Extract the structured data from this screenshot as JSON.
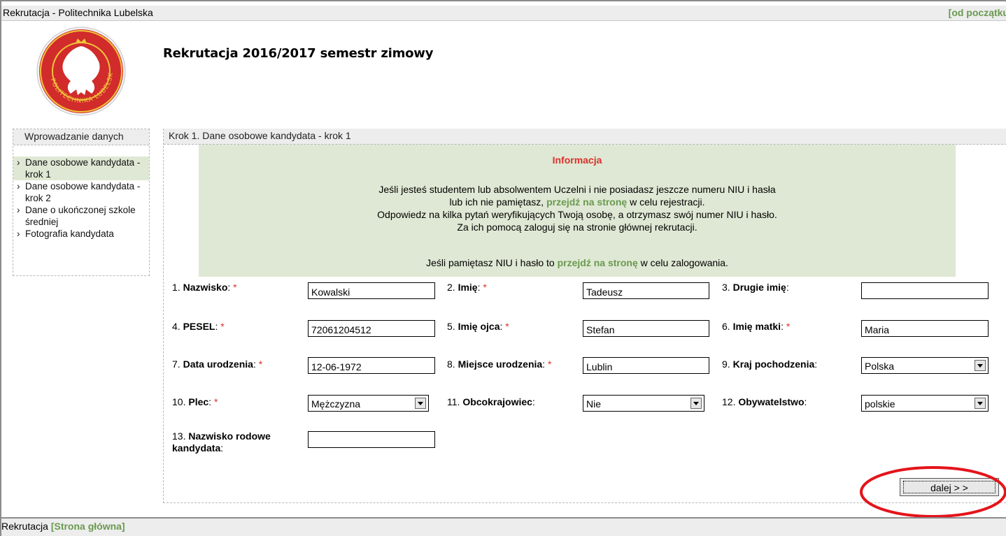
{
  "top_bar": {
    "title": "Rekrutacja - Politechnika Lubelska",
    "restart_link": "[od początku"
  },
  "logo": {
    "text": "POLITECHNIKA LUBELSKA"
  },
  "heading": "Rekrutacja 2016/2017 semestr zimowy",
  "sidebar": {
    "title": "Wprowadzanie danych",
    "items": [
      {
        "label": "Dane osobowe kandydata - krok 1",
        "active": true
      },
      {
        "label": "Dane osobowe kandydata - krok 2",
        "active": false
      },
      {
        "label": "Dane o ukończonej szkole średniej",
        "active": false
      },
      {
        "label": "Fotografia kandydata",
        "active": false
      }
    ]
  },
  "main": {
    "step_title": "Krok 1. Dane osobowe kandydata - krok 1",
    "info": {
      "title": "Informacja",
      "line1": "Jeśli jesteś studentem lub absolwentem Uczelni i nie posiadasz jeszcze numeru NIU i hasła",
      "line2_pre": "lub ich nie pamiętasz,",
      "link_text": "przejdź na stronę",
      "line2_post": "w celu rejestracji.",
      "line3": "Odpowiedz na kilka pytań weryfikujących Twoją osobę, a otrzymasz swój numer NIU i hasło.",
      "line4": "Za ich pomocą zaloguj się na stronie głównej rekrutacji.",
      "line5_pre": "Jeśli pamiętasz NIU i hasło to",
      "line5_post": "w celu zalogowania."
    },
    "fields": {
      "f1": {
        "num": "1.",
        "label": "Nazwisko",
        "colon": ":",
        "req": "*",
        "value": "Kowalski"
      },
      "f2": {
        "num": "2.",
        "label": "Imię",
        "colon": ":",
        "req": "*",
        "value": "Tadeusz"
      },
      "f3": {
        "num": "3.",
        "label": "Drugie imię",
        "colon": ":",
        "value": ""
      },
      "f4": {
        "num": "4.",
        "label": "PESEL",
        "colon": ":",
        "req": "*",
        "value": "72061204512"
      },
      "f5": {
        "num": "5.",
        "label": "Imię ojca",
        "colon": ":",
        "req": "*",
        "value": "Stefan"
      },
      "f6": {
        "num": "6.",
        "label": "Imię matki",
        "colon": ":",
        "req": "*",
        "value": "Maria"
      },
      "f7": {
        "num": "7.",
        "label": "Data urodzenia",
        "colon": ":",
        "req": "*",
        "value": "12-06-1972"
      },
      "f8": {
        "num": "8.",
        "label": "Miejsce urodzenia",
        "colon": ":",
        "req": "*",
        "value": "Lublin"
      },
      "f9": {
        "num": "9.",
        "label": "Kraj pochodzenia",
        "colon": ":",
        "value": "Polska"
      },
      "f10": {
        "num": "10.",
        "label": "Plec",
        "colon": ":",
        "req": "*",
        "value": "Mężczyzna"
      },
      "f11": {
        "num": "11.",
        "label": "Obcokrajowiec",
        "colon": ":",
        "value": "Nie"
      },
      "f12": {
        "num": "12.",
        "label": "Obywatelstwo",
        "colon": ":",
        "value": "polskie"
      },
      "f13": {
        "num": "13.",
        "label_line1": "Nazwisko rodowe",
        "label_line2": "kandydata",
        "colon": ":",
        "value": ""
      }
    },
    "next_button": "dalej > >"
  },
  "bottom_bar": {
    "title": "Rekrutacja",
    "home_link": "[Strona główna]"
  },
  "colors": {
    "accent_green": "#6a9a50",
    "info_bg": "#dfe8d4",
    "required_red": "#d9302a",
    "annotation_red": "#e4141b"
  }
}
